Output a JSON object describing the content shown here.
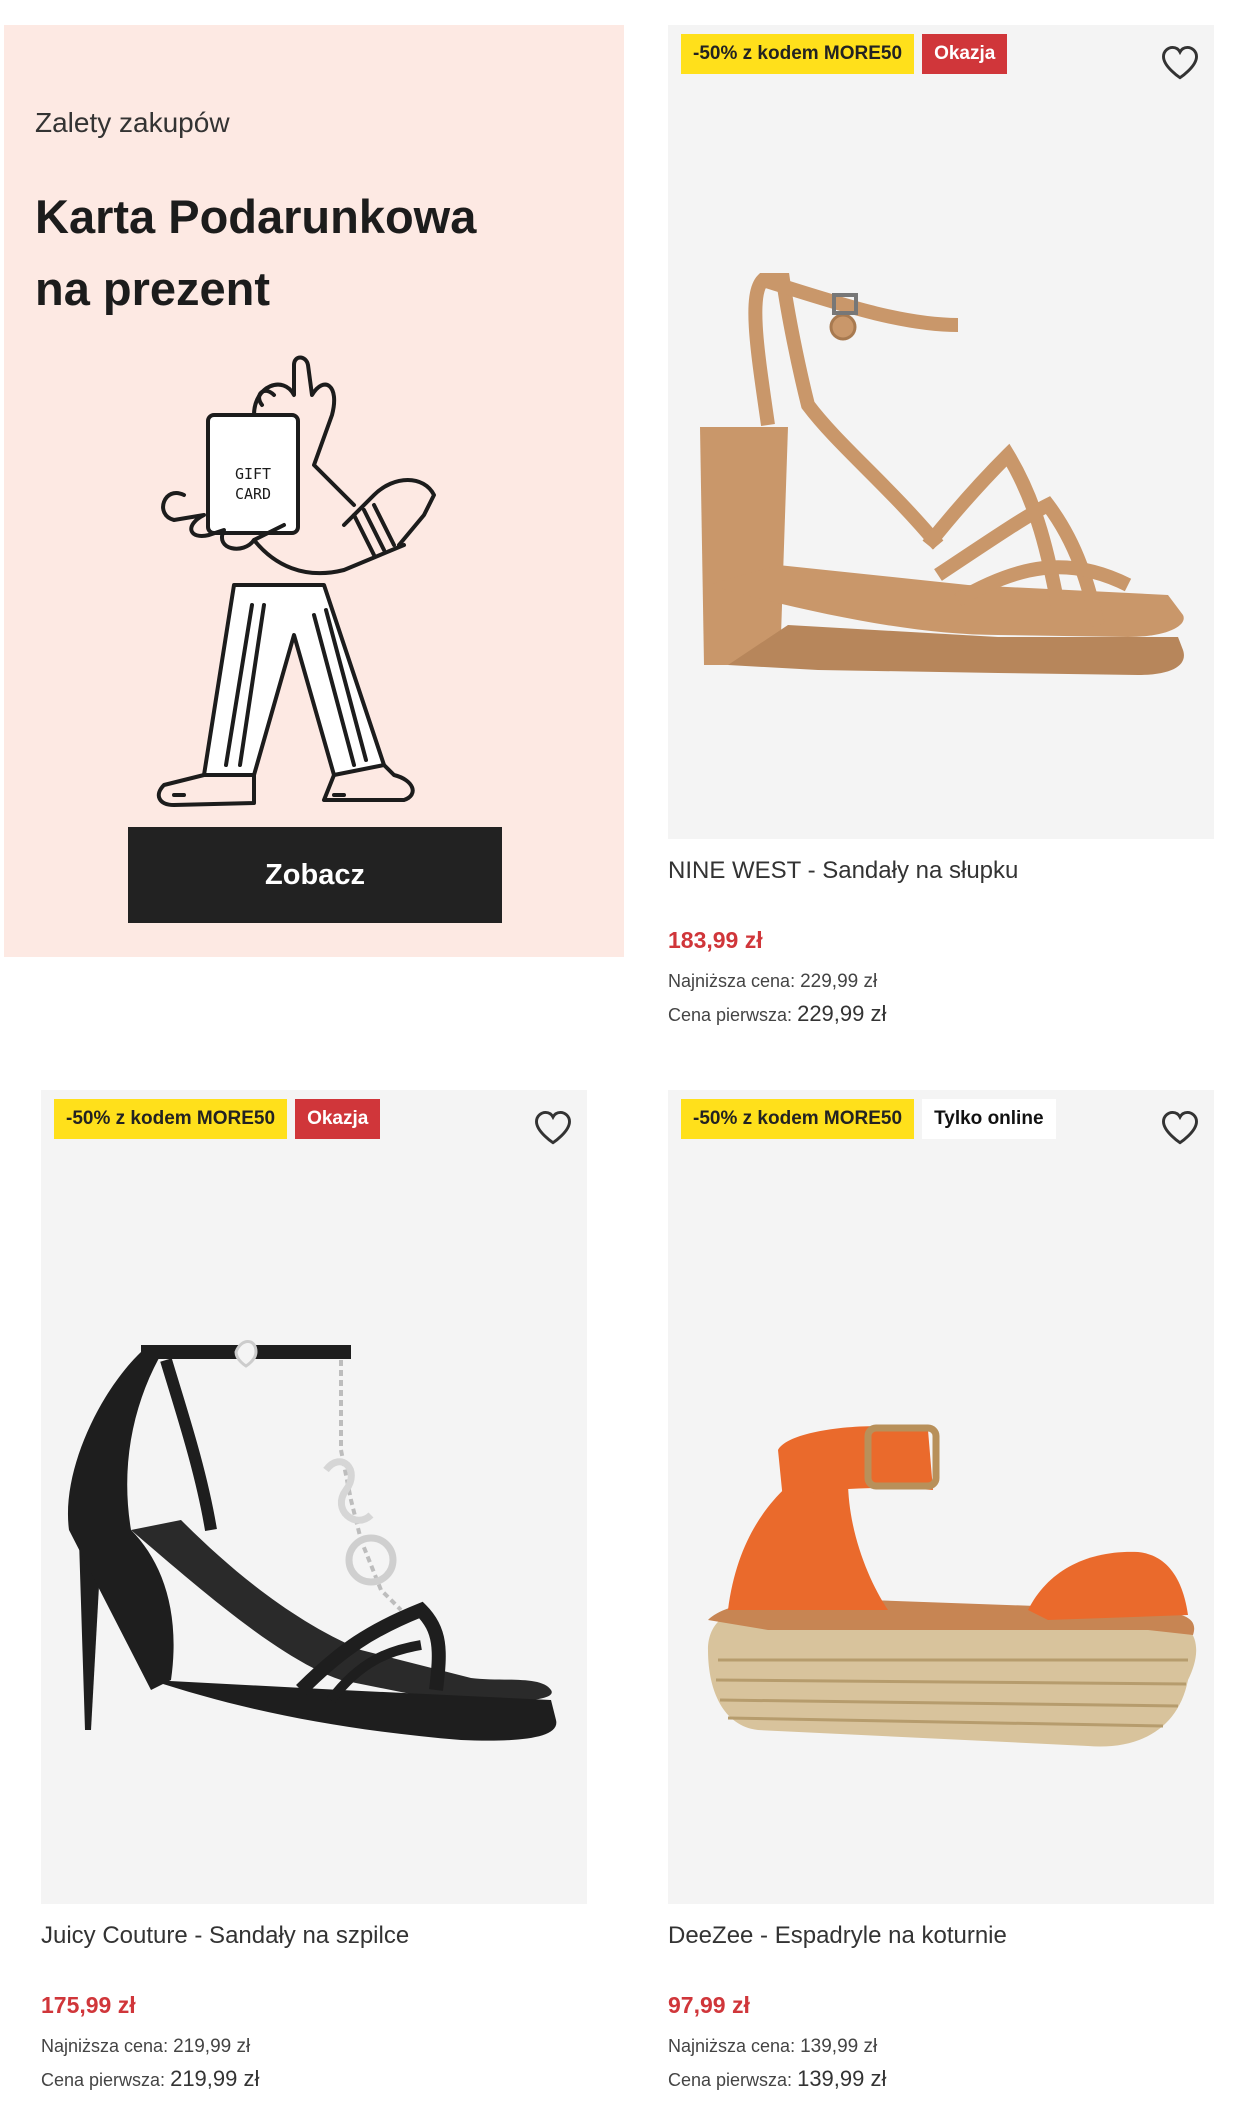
{
  "promo": {
    "eyebrow": "Zalety zakupów",
    "title_line1": "Karta Podarunkowa",
    "title_line2": "na prezent",
    "card_text_1": "GIFT",
    "card_text_2": "CARD",
    "cta_label": "Zobacz"
  },
  "products": [
    {
      "badges": [
        "-50% z kodem MORE50",
        "Okazja"
      ],
      "name": "NINE WEST - Sandały na słupku",
      "price": "183,99 zł",
      "lowest_label": "Najniższa cena:",
      "lowest_value": "229,99 zł",
      "first_label": "Cena pierwsza:",
      "first_value": "229,99 zł",
      "shoe_color": "#c9976a"
    },
    {
      "badges": [
        "-50% z kodem MORE50",
        "Okazja"
      ],
      "name": "Juicy Couture - Sandały na szpilce",
      "price": "175,99 zł",
      "lowest_label": "Najniższa cena:",
      "lowest_value": "219,99 zł",
      "first_label": "Cena pierwsza:",
      "first_value": "219,99 zł",
      "shoe_color": "#1e1e1e"
    },
    {
      "badges": [
        "-50% z kodem MORE50",
        "Tylko online"
      ],
      "name": "DeeZee - Espadryle na koturnie",
      "price": "97,99 zł",
      "lowest_label": "Najniższa cena:",
      "lowest_value": "139,99 zł",
      "first_label": "Cena pierwsza:",
      "first_value": "139,99 zł",
      "shoe_color": "#ea6a2c"
    }
  ],
  "icons": {
    "wishlist": "heart-outline-icon"
  },
  "colors": {
    "price_red": "#d0363a",
    "badge_yellow": "#ffe01b",
    "badge_red": "#d0363a",
    "promo_bg": "#fde9e3"
  }
}
